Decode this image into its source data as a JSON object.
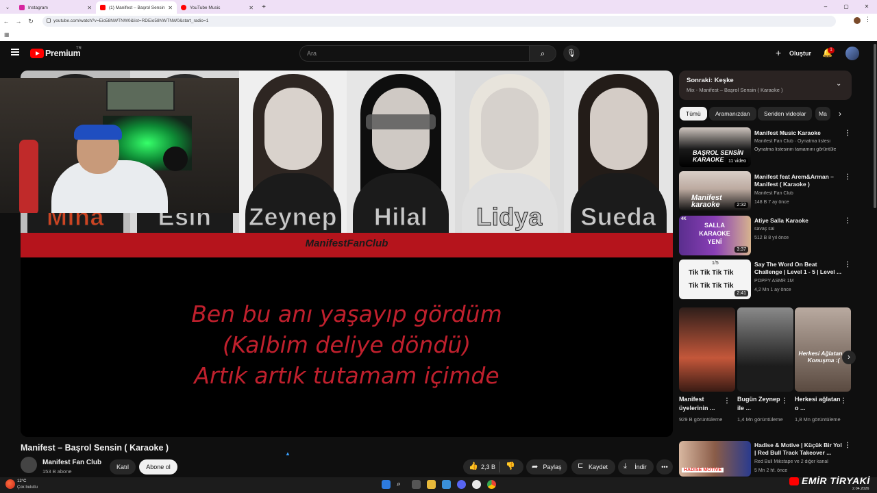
{
  "browser": {
    "tabs": [
      {
        "title": "Instagram",
        "color": "#d6249f"
      },
      {
        "title": "(1) Manifest – Başrol Sensin",
        "color": "#ff0000"
      },
      {
        "title": "YouTube Music",
        "color": "#ff0000"
      }
    ],
    "url": "youtube.com/watch?v=Eio58NWTNW0&list=RDEio58NWTNW0&start_radio=1"
  },
  "header": {
    "brand": "Premium",
    "region": "TR",
    "search_placeholder": "Ara",
    "create_label": "Oluştur",
    "notification_count": "1"
  },
  "player": {
    "names": [
      "Mina",
      "Esin",
      "Zeynep",
      "Hilal",
      "Lidya",
      "Sueda"
    ],
    "banner": "ManifestFanClub",
    "lyrics": [
      "Ben bu anı yaşayıp gördüm",
      "(Kalbim deliye döndü)",
      "Artık artık tutamam içimde"
    ]
  },
  "video": {
    "title": "Manifest – Başrol Sensin ( Karaoke )",
    "channel": "Manifest Fan Club",
    "subscribers": "153 B abone",
    "join_label": "Katıl",
    "subscribe_label": "Abone ol",
    "likes": "2,3 B",
    "share_label": "Paylaş",
    "save_label": "Kaydet",
    "download_label": "İndir"
  },
  "sidebar": {
    "up_next_title": "Sonraki: Keşke",
    "up_next_sub": "Mix - Manifest – Başrol Sensin ( Karaoke )",
    "chips": [
      "Tümü",
      "Aramanızdan",
      "Seriden videolar",
      "Ma"
    ],
    "recs": [
      {
        "title": "Manifest Music Karaoke",
        "line1": "Manifest Fan Club · Oynatma listesi",
        "line2": "Oynatma listesinin tamamını görüntüle",
        "badge": "11 video",
        "thumb_text": "BAŞROL SENSİN KARAOKE"
      },
      {
        "title": "Manifest feat Arem&Arman – Manifest ( Karaoke )",
        "line1": "Manifest Fan Club",
        "line2": "148 B  7 ay önce",
        "badge": "2:32",
        "thumb_text": "Manifest karaoke"
      },
      {
        "title": "Atiye Salla Karaoke",
        "line1": "savaş sal",
        "line2": "512 B  8 yıl önce",
        "badge": "3:37",
        "thumb_text": "SALLA KARAOKE YENİ",
        "tag": "4K"
      },
      {
        "title": "Say The Word On Beat Challenge | Level 1 - 5 | Level ...",
        "line1": "POPPY ASMR 1M",
        "line2": "4,2 Mn  1 ay önce",
        "badge": "2:41",
        "thumb_text": "Tik Tik Tik Tik",
        "counter": "1/5"
      }
    ],
    "shorts": [
      {
        "title": "Manifest üyelerinin ...",
        "views": "929 B görüntüleme"
      },
      {
        "title": "Bugün Zeynep ile ...",
        "views": "1,4 Mn görüntüleme"
      },
      {
        "title": "Herkesi ağlatan o ...",
        "views": "1,8 Mn görüntüleme",
        "overlay": "Herkesi Ağlatan O Konuşma :("
      }
    ],
    "last_rec": {
      "title": "Hadise & Motive | Küçük Bir Yol | Red Bull Track Takeover ...",
      "line1": "Red Bull Mikstape  ve 2 diğer kanal",
      "line2": "5 Mn  2 hf. önce",
      "thumb_text": "HADISE  MOTIVE"
    }
  },
  "taskbar": {
    "weather_temp": "12°C",
    "weather_desc": "Çok bulutlu",
    "watermark": "EMİR TİRYAKİ",
    "date": "2.04.2026"
  }
}
